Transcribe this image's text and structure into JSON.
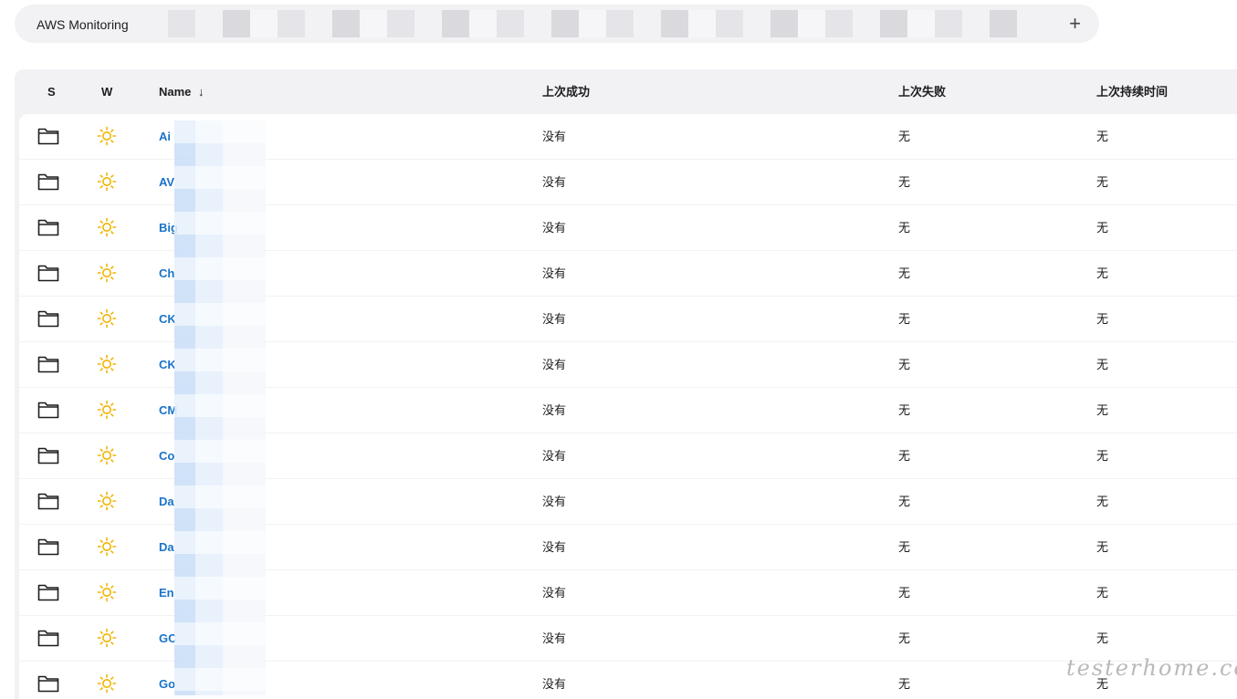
{
  "tabs": {
    "active_label": "AWS Monitoring",
    "add_label": "+"
  },
  "table": {
    "headers": {
      "status": "S",
      "weather": "W",
      "name": "Name",
      "sort_indicator": "↓",
      "last_success": "上次成功",
      "last_failure": "上次失败",
      "last_duration": "上次持续时间"
    },
    "rows": [
      {
        "name": "Ai",
        "last_success": "没有",
        "last_failure": "无",
        "last_duration": "无"
      },
      {
        "name": "AV",
        "last_success": "没有",
        "last_failure": "无",
        "last_duration": "无"
      },
      {
        "name": "Big",
        "last_success": "没有",
        "last_failure": "无",
        "last_duration": "无"
      },
      {
        "name": "Ch",
        "last_success": "没有",
        "last_failure": "无",
        "last_duration": "无"
      },
      {
        "name": "CK",
        "last_success": "没有",
        "last_failure": "无",
        "last_duration": "无"
      },
      {
        "name": "CK",
        "last_success": "没有",
        "last_failure": "无",
        "last_duration": "无"
      },
      {
        "name": "CM",
        "last_success": "没有",
        "last_failure": "无",
        "last_duration": "无"
      },
      {
        "name": "Co",
        "last_success": "没有",
        "last_failure": "无",
        "last_duration": "无"
      },
      {
        "name": "Da",
        "last_success": "没有",
        "last_failure": "无",
        "last_duration": "无"
      },
      {
        "name": "Da",
        "last_success": "没有",
        "last_failure": "无",
        "last_duration": "无"
      },
      {
        "name": "En",
        "last_success": "没有",
        "last_failure": "无",
        "last_duration": "无"
      },
      {
        "name": "GC",
        "last_success": "没有",
        "last_failure": "无",
        "last_duration": "无"
      },
      {
        "name": "Go",
        "last_success": "没有",
        "last_failure": "无",
        "last_duration": "无"
      }
    ],
    "icons": {
      "status": "folder-icon",
      "weather": "sun-icon"
    },
    "colors": {
      "link": "#1a73c9",
      "sun": "#f0b400"
    }
  },
  "watermark": "testerhome.com"
}
